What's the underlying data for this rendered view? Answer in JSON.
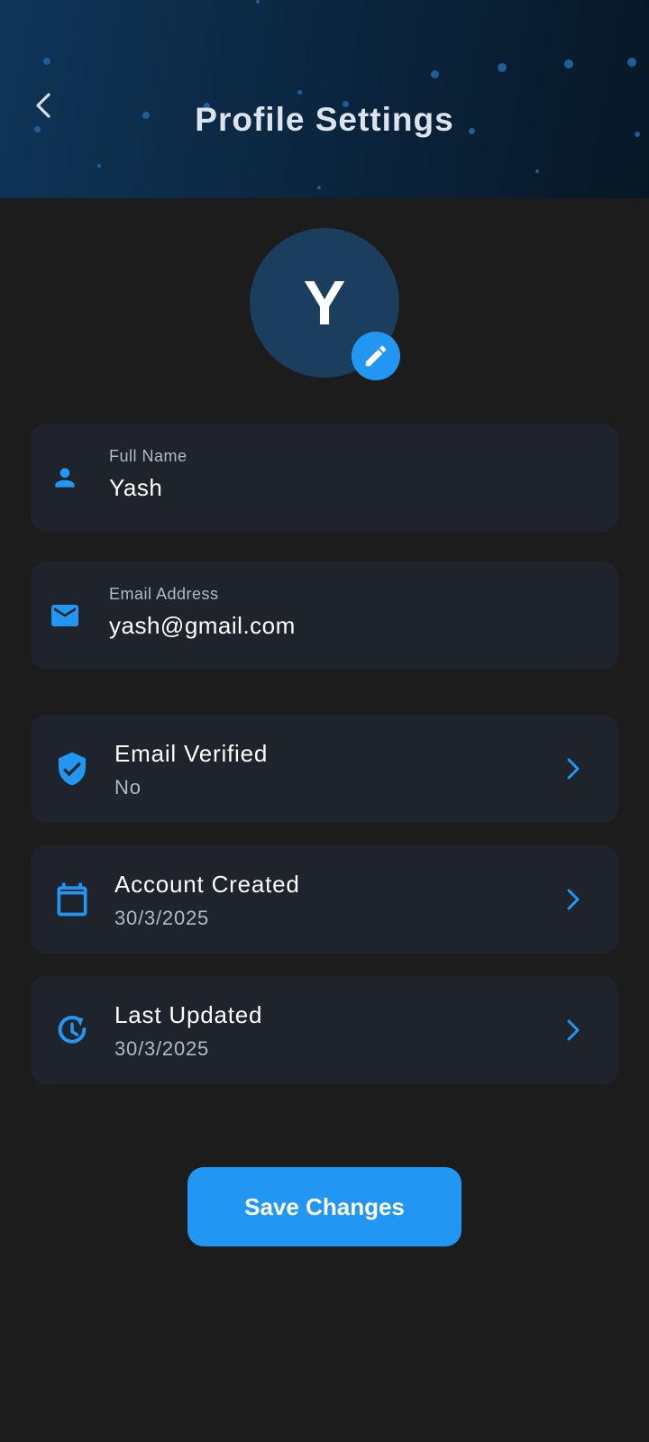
{
  "header": {
    "title": "Profile Settings"
  },
  "avatar": {
    "initial": "Y"
  },
  "fields": [
    {
      "label": "Full Name",
      "value": "Yash"
    },
    {
      "label": "Email Address",
      "value": "yash@gmail.com"
    }
  ],
  "info": [
    {
      "title": "Email Verified",
      "value": "No"
    },
    {
      "title": "Account Created",
      "value": "30/3/2025"
    },
    {
      "title": "Last Updated",
      "value": "30/3/2025"
    }
  ],
  "actions": {
    "save_label": "Save Changes"
  },
  "colors": {
    "accent": "#2196f3",
    "background": "#1c1c1c",
    "card": "#1f232b",
    "header": "#0b2742",
    "avatar_bg": "#1b3e5e"
  }
}
